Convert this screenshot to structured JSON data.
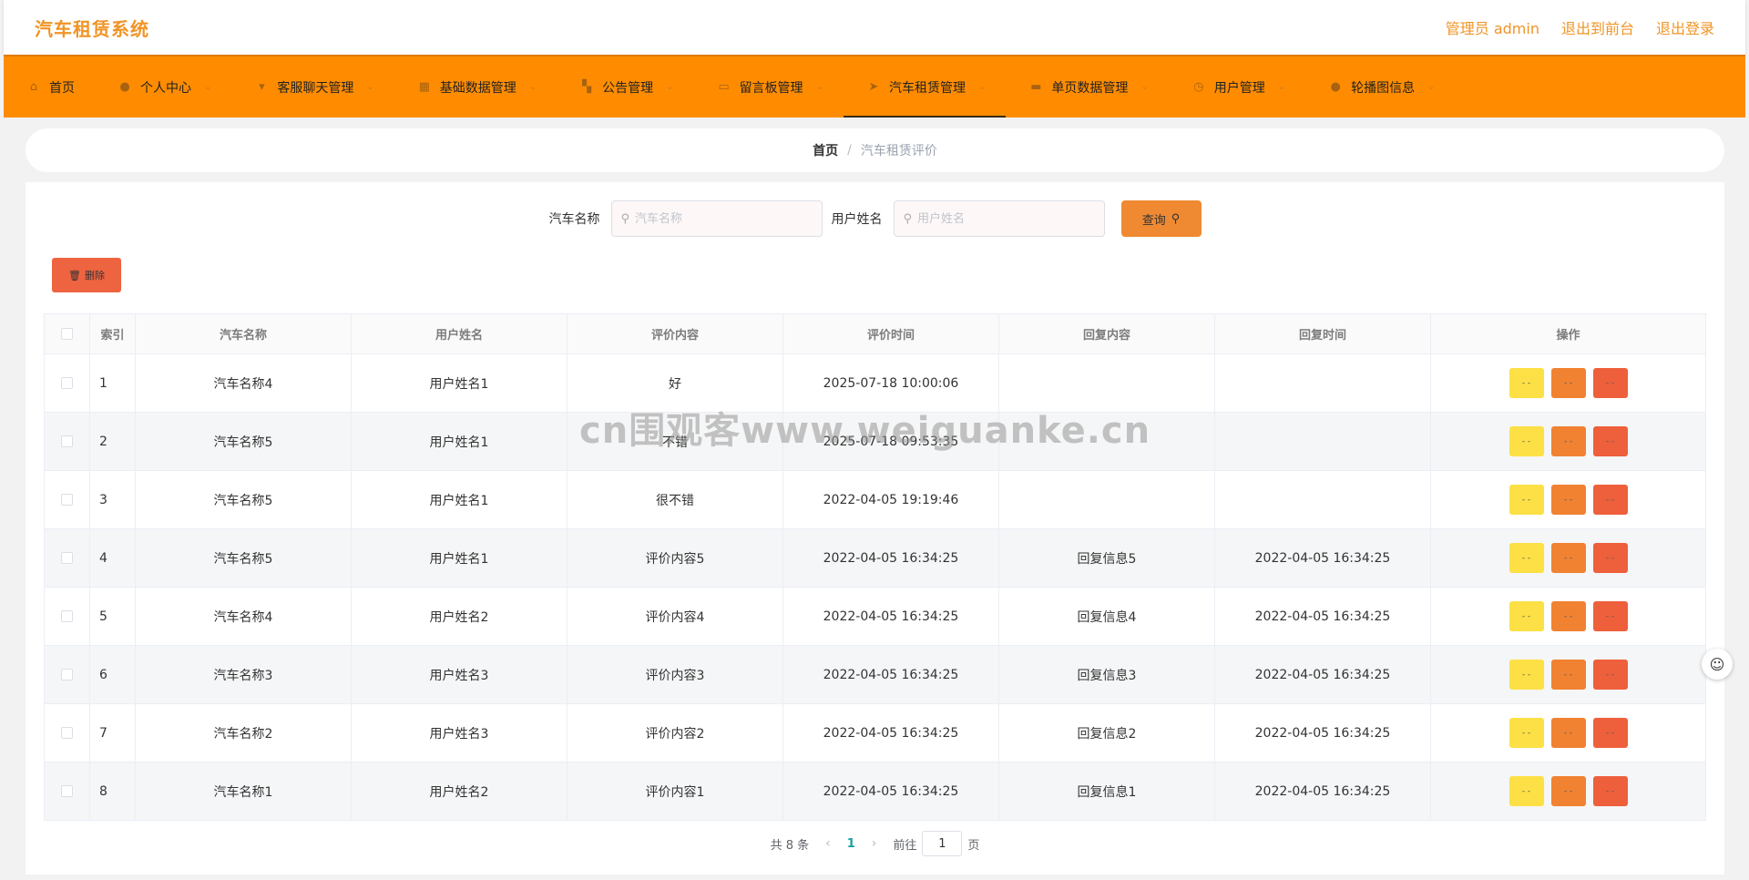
{
  "header": {
    "title": "汽车租赁系统",
    "actions": [
      "管理员 admin",
      "退出到前台",
      "退出登录"
    ]
  },
  "nav": {
    "items": [
      {
        "label": "首页",
        "icon": "home-icon",
        "glyph": "⌂",
        "caret": false
      },
      {
        "label": "个人中心",
        "icon": "user-icon",
        "glyph": "●",
        "caret": true
      },
      {
        "label": "客服聊天管理",
        "icon": "chat-icon",
        "glyph": "▾",
        "caret": true
      },
      {
        "label": "基础数据管理",
        "icon": "grid-icon",
        "glyph": "▦",
        "caret": true
      },
      {
        "label": "公告管理",
        "icon": "apps-icon",
        "glyph": "▚",
        "caret": true
      },
      {
        "label": "留言板管理",
        "icon": "message-icon",
        "glyph": "▭",
        "caret": true
      },
      {
        "label": "汽车租赁管理",
        "icon": "navigation-icon",
        "glyph": "➤",
        "caret": true,
        "active": true
      },
      {
        "label": "单页数据管理",
        "icon": "page-icon",
        "glyph": "▬",
        "caret": true
      },
      {
        "label": "用户管理",
        "icon": "clock-icon",
        "glyph": "◷",
        "caret": true
      },
      {
        "label": "轮播图信息",
        "icon": "user-icon",
        "glyph": "●",
        "caret": true
      }
    ]
  },
  "breadcrumb": {
    "home": "首页",
    "sep": "/",
    "current": "汽车租赁评价"
  },
  "search": {
    "car_label": "汽车名称",
    "car_placeholder": "汽车名称",
    "user_label": "用户姓名",
    "user_placeholder": "用户姓名",
    "query_label": "查询"
  },
  "toolbar": {
    "delete_label": "删除"
  },
  "table": {
    "columns": [
      "索引",
      "汽车名称",
      "用户姓名",
      "评价内容",
      "评价时间",
      "回复内容",
      "回复时间",
      "操作"
    ],
    "rows": [
      {
        "idx": "1",
        "car": "汽车名称4",
        "user": "用户姓名1",
        "content": "好",
        "time": "2025-07-18 10:00:06",
        "reply": "",
        "reply_time": ""
      },
      {
        "idx": "2",
        "car": "汽车名称5",
        "user": "用户姓名1",
        "content": "不错",
        "time": "2025-07-18 09:53:35",
        "reply": "",
        "reply_time": ""
      },
      {
        "idx": "3",
        "car": "汽车名称5",
        "user": "用户姓名1",
        "content": "很不错",
        "time": "2022-04-05 19:19:46",
        "reply": "",
        "reply_time": ""
      },
      {
        "idx": "4",
        "car": "汽车名称5",
        "user": "用户姓名1",
        "content": "评价内容5",
        "time": "2022-04-05 16:34:25",
        "reply": "回复信息5",
        "reply_time": "2022-04-05 16:34:25"
      },
      {
        "idx": "5",
        "car": "汽车名称4",
        "user": "用户姓名2",
        "content": "评价内容4",
        "time": "2022-04-05 16:34:25",
        "reply": "回复信息4",
        "reply_time": "2022-04-05 16:34:25"
      },
      {
        "idx": "6",
        "car": "汽车名称3",
        "user": "用户姓名3",
        "content": "评价内容3",
        "time": "2022-04-05 16:34:25",
        "reply": "回复信息3",
        "reply_time": "2022-04-05 16:34:25"
      },
      {
        "idx": "7",
        "car": "汽车名称2",
        "user": "用户姓名3",
        "content": "评价内容2",
        "time": "2022-04-05 16:34:25",
        "reply": "回复信息2",
        "reply_time": "2022-04-05 16:34:25"
      },
      {
        "idx": "8",
        "car": "汽车名称1",
        "user": "用户姓名2",
        "content": "评价内容1",
        "time": "2022-04-05 16:34:25",
        "reply": "回复信息1",
        "reply_time": "2022-04-05 16:34:25"
      }
    ],
    "op_glyph": "- -"
  },
  "pagination": {
    "total": "共 8 条",
    "current_page": "1",
    "goto_prefix": "前往",
    "goto_value": "1",
    "goto_suffix": "页"
  },
  "watermark": "cn围观客www.weiguanke.cn",
  "colors": {
    "brand": "#ff8c00",
    "title": "#f09426",
    "view_button": "#fce045",
    "edit_button": "#f08232",
    "delete_button": "#ee5f3c"
  }
}
